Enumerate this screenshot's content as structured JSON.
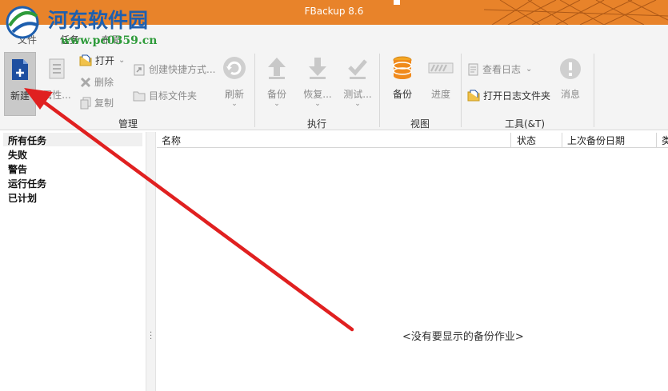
{
  "window": {
    "title": "FBackup 8.6"
  },
  "watermark": {
    "site_name": "河东软件园",
    "url": "www.pc0359.cn"
  },
  "menu": {
    "tabs": [
      {
        "label": "文件"
      },
      {
        "label": "任务"
      },
      {
        "label": "布局"
      }
    ],
    "active_tab": "任务"
  },
  "ribbon": {
    "groups": {
      "manage": {
        "label": "管理",
        "new": "新建",
        "properties": "属性...",
        "open": "打开",
        "delete": "删除",
        "copy": "复制",
        "create_shortcut": "创建快捷方式...",
        "target_folder": "目标文件夹",
        "refresh": "刷新"
      },
      "execute": {
        "label": "执行",
        "backup": "备份",
        "restore": "恢复...",
        "test": "测试..."
      },
      "view": {
        "label": "视图",
        "backup": "备份",
        "progress": "进度"
      },
      "tools": {
        "label": "工具(&T)",
        "view_log": "查看日志",
        "open_log_folder": "打开日志文件夹",
        "messages": "消息"
      }
    }
  },
  "sidebar": {
    "items": [
      {
        "label": "所有任务"
      },
      {
        "label": "失败"
      },
      {
        "label": "警告"
      },
      {
        "label": "运行任务"
      },
      {
        "label": "已计划"
      }
    ],
    "selected": "所有任务"
  },
  "grid": {
    "columns": [
      {
        "label": "名称"
      },
      {
        "label": "状态"
      },
      {
        "label": "上次备份日期"
      },
      {
        "label": "类"
      }
    ],
    "empty_message": "<没有要显示的备份作业>"
  },
  "colors": {
    "accent": "#e8832a",
    "ribbon_bg": "#f4f4f4",
    "annotation_arrow": "#e02020",
    "watermark_text": "#1e5fae",
    "watermark_url": "#2e9b3a"
  }
}
